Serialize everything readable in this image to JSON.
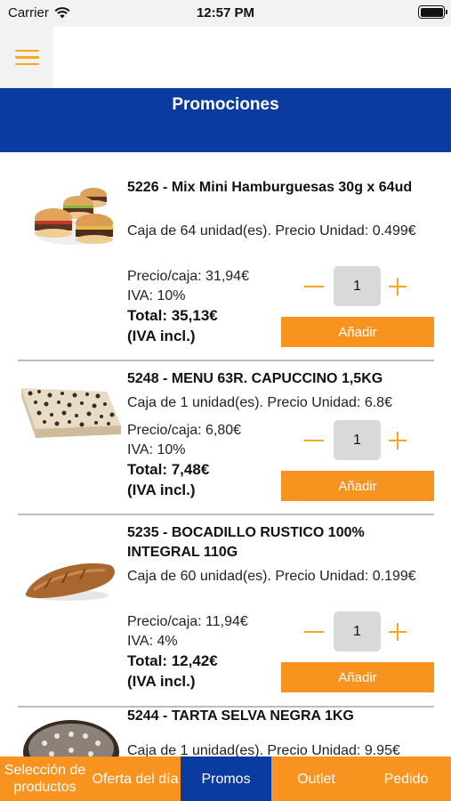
{
  "status_bar": {
    "carrier": "Carrier",
    "time": "12:57 PM"
  },
  "header": {
    "menu_icon": "hamburger-icon",
    "title": "Promociones"
  },
  "products": [
    {
      "name": "5226 - Mix Mini Hamburguesas 30g x 64ud",
      "description": "Caja de 64 unidad(es). Precio Unidad: 0.499€",
      "price_box": "Precio/caja: 31,94€",
      "vat": "IVA: 10%",
      "total": "Total: 35,13€",
      "total_note": "(IVA incl.)",
      "quantity": "1",
      "add_label": "Añadir",
      "image": "mini-burgers-image"
    },
    {
      "name": "5248 - MENU 63R. CAPUCCINO 1,5KG",
      "description": "Caja de 1 unidad(es). Precio Unidad: 6.8€",
      "price_box": "Precio/caja: 6,80€",
      "vat": "IVA: 10%",
      "total": "Total: 7,48€",
      "total_note": "(IVA incl.)",
      "quantity": "1",
      "add_label": "Añadir",
      "image": "capuccino-cake-image"
    },
    {
      "name": "5235 - BOCADILLO RUSTICO 100% INTEGRAL 110G",
      "description": "Caja de 60 unidad(es). Precio Unidad: 0.199€",
      "price_box": "Precio/caja: 11,94€",
      "vat": "IVA: 4%",
      "total": "Total: 12,42€",
      "total_note": "(IVA incl.)",
      "quantity": "1",
      "add_label": "Añadir",
      "image": "bread-roll-image"
    },
    {
      "name": "5244 - TARTA SELVA NEGRA 1KG",
      "description": "Caja de 1 unidad(es). Precio Unidad: 9.95€",
      "image": "black-forest-cake-image"
    }
  ],
  "bottom_nav": [
    {
      "label": "Selección de productos",
      "active": false
    },
    {
      "label": "Oferta del día",
      "active": false
    },
    {
      "label": "Promos",
      "active": true
    },
    {
      "label": "Outlet",
      "active": false
    },
    {
      "label": "Pedido",
      "active": false
    }
  ],
  "colors": {
    "brand_blue": "#0a3ca0",
    "accent_orange": "#f7931e",
    "qty_box": "#d9d9d9"
  }
}
